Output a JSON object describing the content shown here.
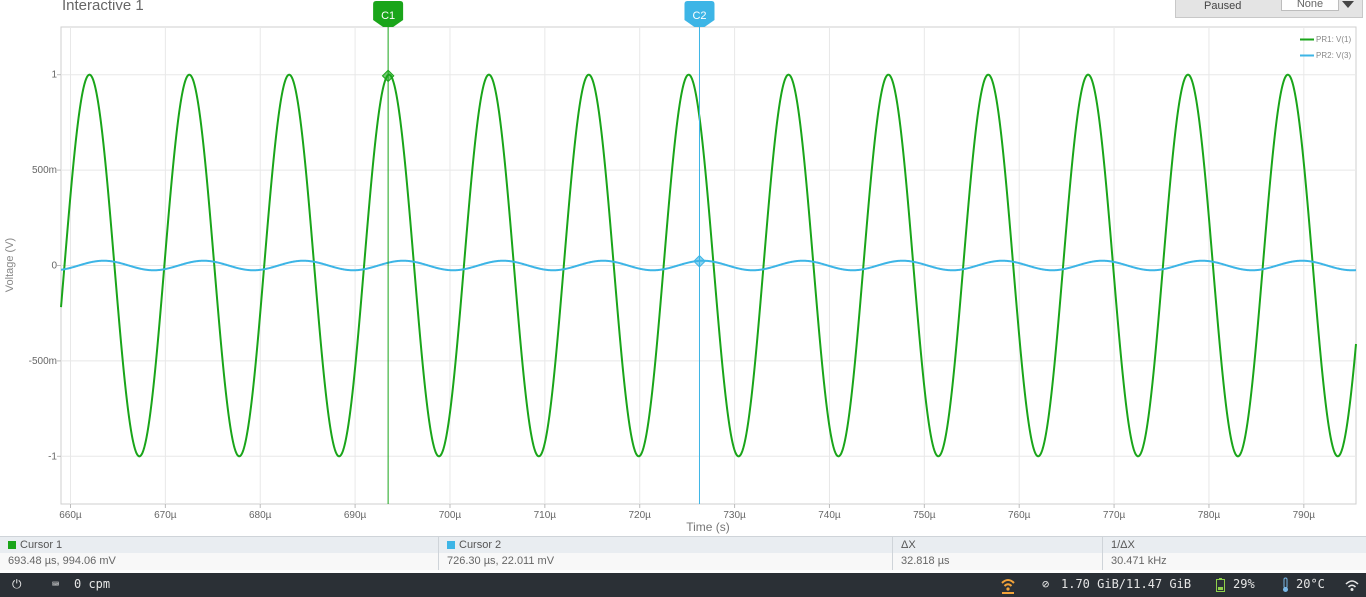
{
  "window": {
    "title": "Interactive 1"
  },
  "controls": {
    "status": "Paused",
    "select_value": "None"
  },
  "colors": {
    "series1": "#1aa51a",
    "series2": "#3db5e6",
    "grid": "#e8e8e8",
    "axis": "#cfcfcf"
  },
  "chart_data": {
    "type": "line",
    "xlabel": "Time (s)",
    "ylabel": "Voltage (V)",
    "xlim": [
      659,
      795.5
    ],
    "ylim": [
      -1.25,
      1.25
    ],
    "grid": true,
    "legend_position": "top-right",
    "x_ticks": [
      {
        "value": 660,
        "label": "660µ"
      },
      {
        "value": 670,
        "label": "670µ"
      },
      {
        "value": 680,
        "label": "680µ"
      },
      {
        "value": 690,
        "label": "690µ"
      },
      {
        "value": 700,
        "label": "700µ"
      },
      {
        "value": 710,
        "label": "710µ"
      },
      {
        "value": 720,
        "label": "720µ"
      },
      {
        "value": 730,
        "label": "730µ"
      },
      {
        "value": 740,
        "label": "740µ"
      },
      {
        "value": 750,
        "label": "750µ"
      },
      {
        "value": 760,
        "label": "760µ"
      },
      {
        "value": 770,
        "label": "770µ"
      },
      {
        "value": 780,
        "label": "780µ"
      },
      {
        "value": 790,
        "label": "790µ"
      }
    ],
    "y_ticks": [
      {
        "value": 1,
        "label": "1"
      },
      {
        "value": 0.5,
        "label": "500m"
      },
      {
        "value": 0,
        "label": "0"
      },
      {
        "value": -0.5,
        "label": "-500m"
      },
      {
        "value": -1,
        "label": "-1"
      }
    ],
    "series": [
      {
        "name": "PR1: V(1)",
        "kind": "sine",
        "amplitude": 1,
        "frequency_hz": 95000,
        "phase_ref_us": 662
      },
      {
        "name": "PR2: V(3)",
        "kind": "sine",
        "amplitude": 0.025,
        "frequency_hz": 95000,
        "phase_ref_us": 663.5
      }
    ],
    "cursors": [
      {
        "label": "C1",
        "x": 693.48,
        "y": 0.99406
      },
      {
        "label": "C2",
        "x": 726.3,
        "y": 0.022011
      }
    ]
  },
  "cursor_table": {
    "cursor1": {
      "header": "Cursor 1",
      "value": "693.48 µs, 994.06 mV"
    },
    "cursor2": {
      "header": "Cursor 2",
      "value": "726.30 µs, 22.011 mV"
    },
    "dx": {
      "header": "ΔX",
      "value": "32.818 µs"
    },
    "inv_dx": {
      "header": "1/ΔX",
      "value": "30.471 kHz"
    }
  },
  "taskbar": {
    "cpm": "0 cpm",
    "memory": "1.70 GiB/11.47 GiB",
    "battery": "29%",
    "temperature": "20°C"
  }
}
